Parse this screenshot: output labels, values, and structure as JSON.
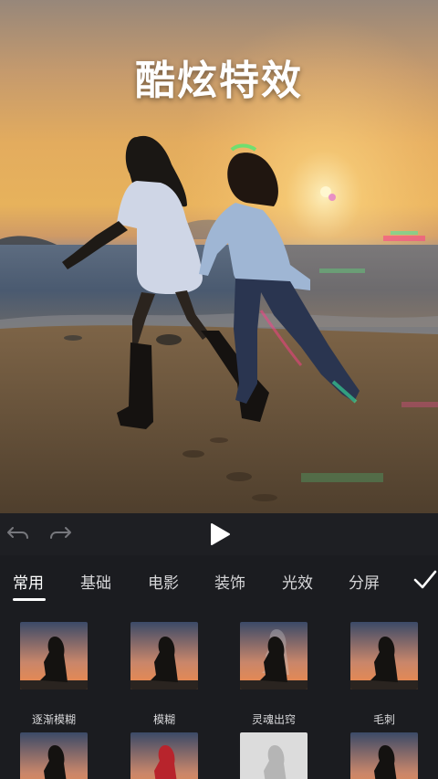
{
  "preview": {
    "title": "酷炫特效"
  },
  "controls": {
    "undo_icon": "undo-arrow-icon",
    "redo_icon": "redo-arrow-icon",
    "play_icon": "play-icon"
  },
  "tabs": [
    {
      "label": "常用",
      "active": true
    },
    {
      "label": "基础",
      "active": false
    },
    {
      "label": "电影",
      "active": false
    },
    {
      "label": "装饰",
      "active": false
    },
    {
      "label": "光效",
      "active": false
    },
    {
      "label": "分屏",
      "active": false
    }
  ],
  "confirm_icon": "checkmark-icon",
  "effects": [
    {
      "label": "逐渐模糊"
    },
    {
      "label": "模糊"
    },
    {
      "label": "灵魂出窍"
    },
    {
      "label": "毛刺"
    },
    {
      "label": ""
    },
    {
      "label": ""
    },
    {
      "label": ""
    },
    {
      "label": ""
    }
  ],
  "colors": {
    "background": "#1b1c20",
    "accent": "#ffffff",
    "thumb_sky_top": "#3b4a68",
    "thumb_sky_bottom": "#f08a4a"
  }
}
